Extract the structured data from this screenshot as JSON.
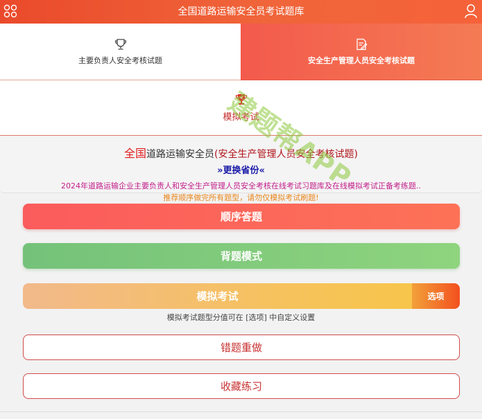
{
  "header": {
    "title": "全国道路运输安全员考试题库",
    "menu_icon": "grid-circles-icon",
    "user_icon": "user-icon"
  },
  "categories": [
    {
      "label": "主要负责人安全考核试题",
      "icon": "trophy-icon",
      "active": false
    },
    {
      "label": "安全生产管理人员安全考核试题",
      "icon": "edit-document-icon",
      "active": true
    }
  ],
  "mock_exam_tab": {
    "label": "模拟考试",
    "icon": "trophy-icon"
  },
  "info": {
    "title_accent": "全国",
    "title_main": "道路运输安全员",
    "title_sub": "(安全生产管理人员安全考核试题)",
    "switch_province": "»更换省份«",
    "description": "2024年道路运输企业主要负责人和安全生产管理人员安全考核在线考试习题库及在线模拟考试正备考练题..",
    "tip": "推荐顺序做完所有题型，请勿仅模拟考试刷题!"
  },
  "buttons": {
    "order": "顺序答题",
    "recite": "背题模式",
    "mock": "模拟考试",
    "options": "选项",
    "mock_hint": "模拟考试题型分值可在 [选项] 中自定义设置",
    "wrong": "错题重做",
    "favorites": "收藏练习"
  },
  "watermark": "建题帮APP",
  "colors": {
    "header": "#ea4a2b",
    "order": "#fb5b5c",
    "recite": "#74c27a",
    "mock": "#f6c25e",
    "options": "#f3501f",
    "outline": "#d24a4a"
  }
}
